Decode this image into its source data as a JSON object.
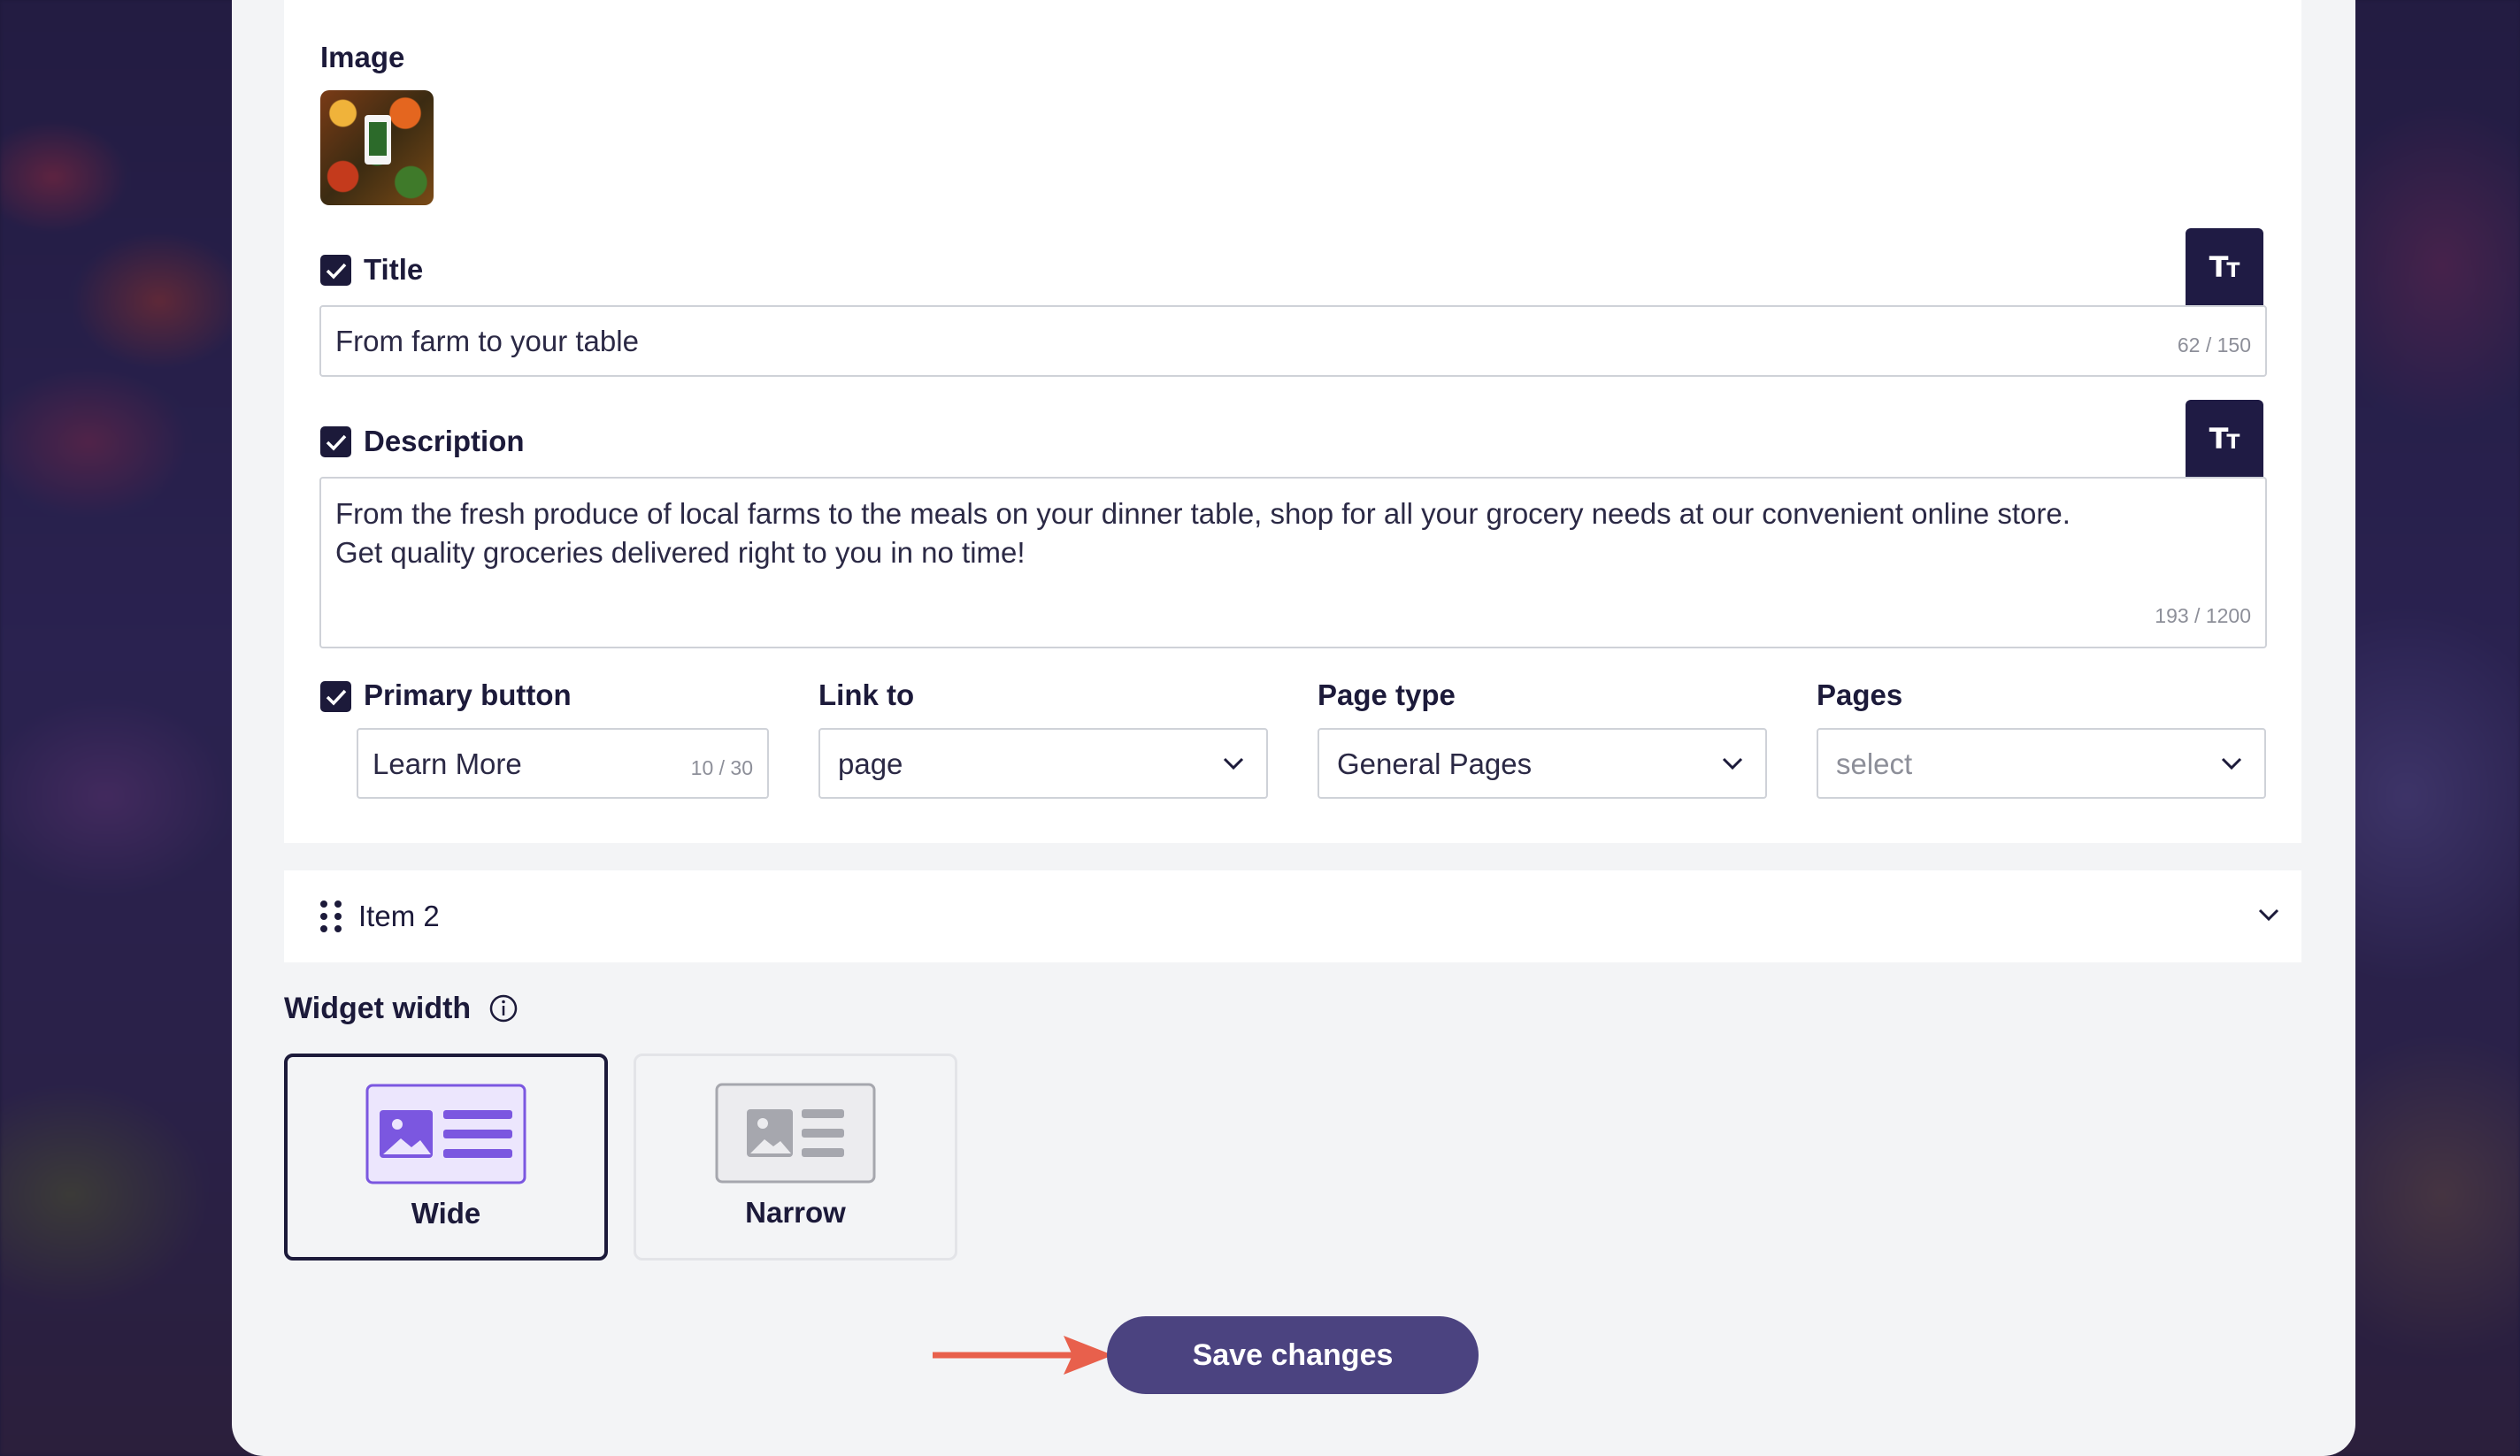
{
  "colors": {
    "primary_dark": "#1c1a3a",
    "button_bg": "#4b4380",
    "accent_purple": "#7b57e0",
    "arrow_red": "#e8604c"
  },
  "image_section": {
    "label": "Image",
    "thumbnail_icon": "produce-image"
  },
  "title_field": {
    "label": "Title",
    "checked": true,
    "value": "From farm to your table",
    "counter": "62 / 150",
    "format_button": "text-format-icon"
  },
  "description_field": {
    "label": "Description",
    "checked": true,
    "value": "From the fresh produce of local farms to the meals on your dinner table, shop for all your grocery needs at our convenient online store. Get quality groceries delivered right to you in no time!",
    "counter": "193 / 1200",
    "format_button": "text-format-icon"
  },
  "primary_button": {
    "label": "Primary button",
    "checked": true,
    "value": "Learn More",
    "counter": "10 / 30"
  },
  "link_to": {
    "label": "Link to",
    "value": "page"
  },
  "page_type": {
    "label": "Page type",
    "value": "General Pages"
  },
  "pages": {
    "label": "Pages",
    "placeholder": "select"
  },
  "item2": {
    "label": "Item 2"
  },
  "widget_width": {
    "label": "Widget width",
    "options": [
      {
        "label": "Wide",
        "selected": true
      },
      {
        "label": "Narrow",
        "selected": false
      }
    ]
  },
  "save_button": {
    "label": "Save changes"
  }
}
